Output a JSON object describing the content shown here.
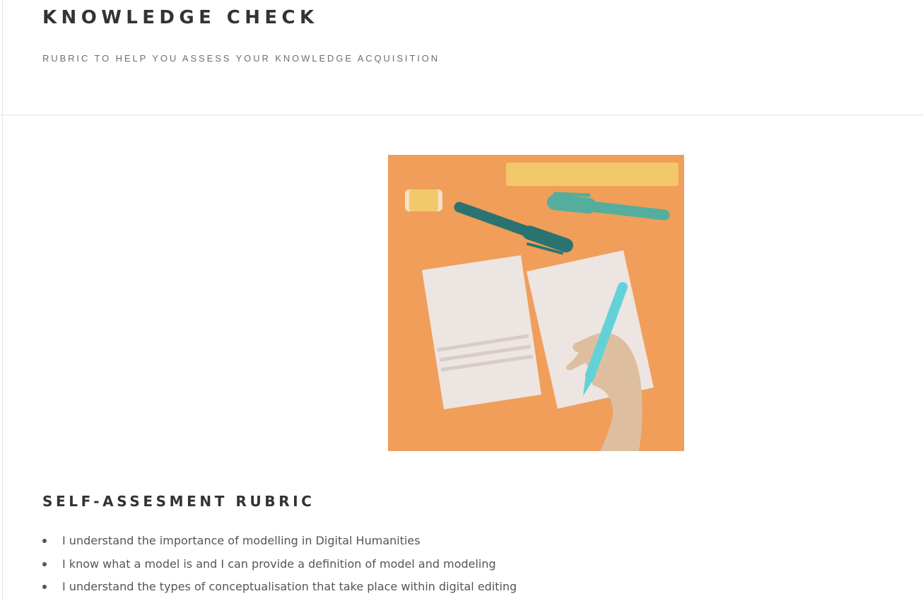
{
  "header": {
    "title": "KNOWLEDGE CHECK",
    "subtitle": "RUBRIC TO HELP YOU ASSESS YOUR KNOWLEDGE ACQUISITION"
  },
  "illustration": {
    "icon": "desk-writing-illustration",
    "colors": {
      "background": "#f09e59",
      "ruler": "#f3c86b",
      "eraser": "#f3c86b",
      "marker_dark": "#2b7370",
      "marker_teal": "#54ae9d",
      "pencil": "#63d2d6",
      "paper": "#ece5e1",
      "paper_lines": "#d8ccc8",
      "hand": "#ddbfa0"
    }
  },
  "rubric": {
    "title": "SELF-ASSESMENT RUBRIC",
    "items": [
      "I understand the importance of modelling in Digital Humanities",
      "I know what a model is and I can provide a definition of model and modeling",
      "I understand the types of conceptualisation that take place within digital editing"
    ]
  },
  "colors": {
    "heading": "#333333",
    "subtitle": "#6e6e6e",
    "body_text": "#555555",
    "divider": "#e2e2e2"
  }
}
